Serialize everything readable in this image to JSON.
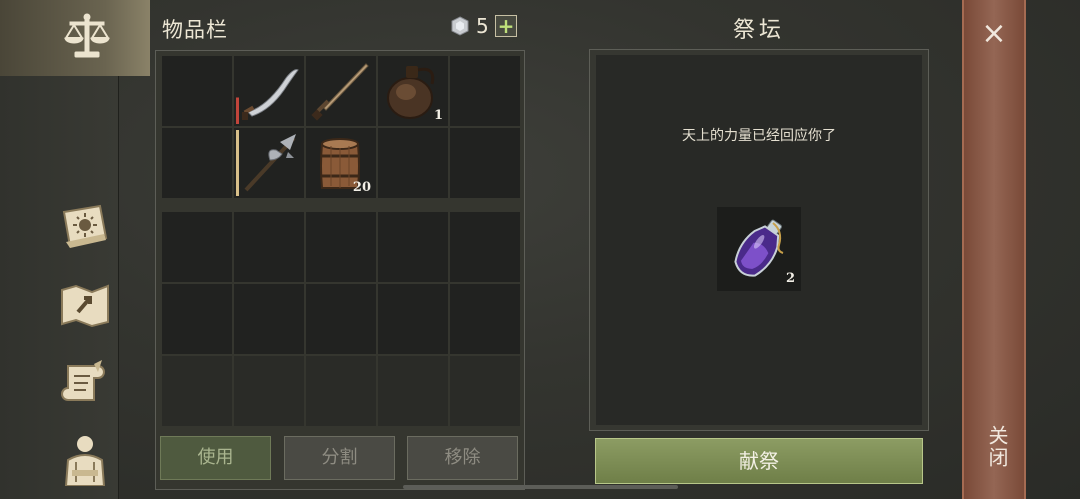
{
  "inventory": {
    "title": "物品栏",
    "currency_count": "5",
    "add_symbol": "+",
    "slots": [
      {
        "item": "empty"
      },
      {
        "item": "scimitar",
        "rarity_color": "#c2453b"
      },
      {
        "item": "sword"
      },
      {
        "item": "leather-flask",
        "qty": "1"
      },
      {
        "item": "empty"
      },
      {
        "item": "empty"
      },
      {
        "item": "halberd",
        "rarity_color": "#d8c08a"
      },
      {
        "item": "wooden-barrel",
        "qty": "20"
      },
      {
        "item": "empty"
      },
      {
        "item": "empty"
      }
    ],
    "buttons": {
      "use": "使用",
      "split": "分割",
      "remove": "移除"
    }
  },
  "altar": {
    "title": "祭坛",
    "message": "天上的力量已经回应你了",
    "offering": {
      "item": "purple-potion",
      "qty": "2"
    },
    "offer_button": "献祭"
  },
  "close": {
    "symbol": "×",
    "label": "关闭"
  },
  "sidebar": {
    "icons": [
      "scales-icon",
      "sun-book-icon",
      "map-icon",
      "quest-scroll-icon",
      "character-icon"
    ]
  }
}
